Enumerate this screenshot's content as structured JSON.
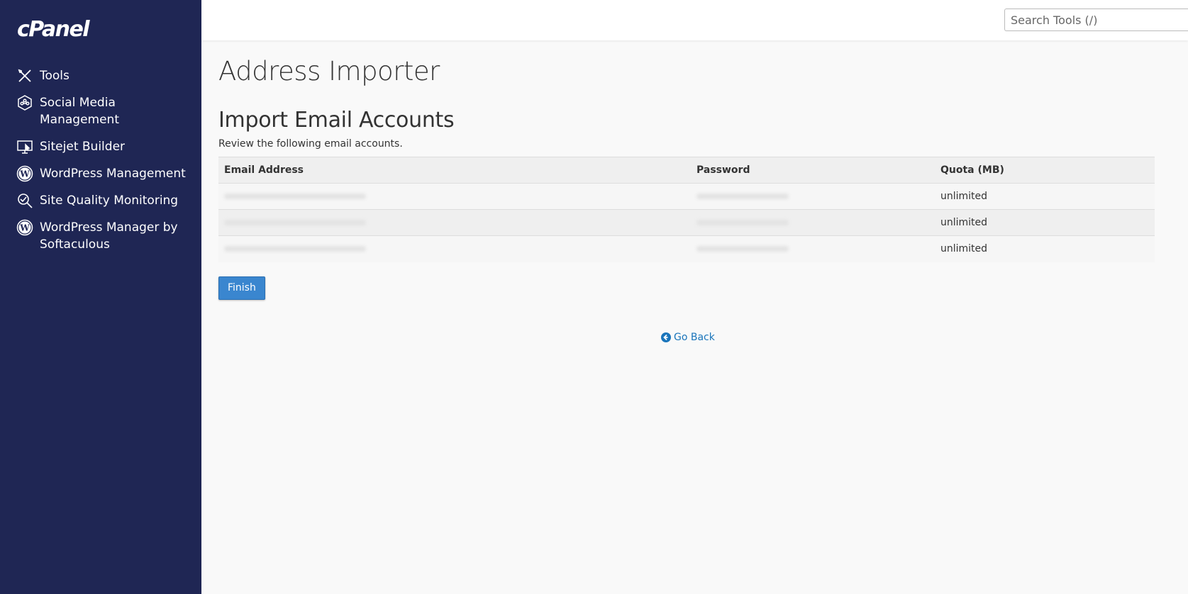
{
  "brand": {
    "logo_text": "cPanel"
  },
  "search": {
    "placeholder": "Search Tools (/)"
  },
  "sidebar": {
    "items": [
      {
        "label": "Tools",
        "icon": "tools-icon"
      },
      {
        "label": "Social Media Management",
        "icon": "social-media-icon"
      },
      {
        "label": "Sitejet Builder",
        "icon": "sitejet-icon"
      },
      {
        "label": "WordPress Management",
        "icon": "wordpress-icon"
      },
      {
        "label": "Site Quality Monitoring",
        "icon": "magnifier-icon"
      },
      {
        "label": "WordPress Manager by Softaculous",
        "icon": "wordpress-icon"
      }
    ]
  },
  "main": {
    "page_title": "Address Importer",
    "section_title": "Import Email Accounts",
    "description": "Review the following email accounts.",
    "table": {
      "headers": [
        "Email Address",
        "Password",
        "Quota (MB)"
      ],
      "rows": [
        {
          "quota": "unlimited"
        },
        {
          "quota": "unlimited"
        },
        {
          "quota": "unlimited"
        }
      ]
    },
    "finish_label": "Finish",
    "go_back_label": "Go Back"
  },
  "colors": {
    "sidebar_bg": "#1f2654",
    "primary_button": "#3a86cf",
    "link": "#1a75bb"
  }
}
